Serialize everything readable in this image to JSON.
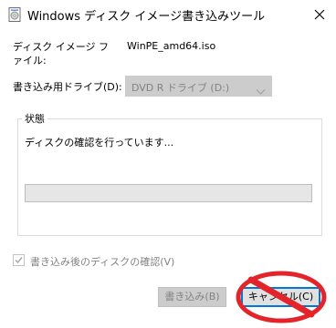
{
  "window": {
    "title": "Windows ディスク イメージ書き込みツール",
    "icon": "disc-writer-icon",
    "close_icon": "close-icon"
  },
  "form": {
    "image_file_label": "ディスク イメージ ファイル:",
    "image_file_value": "WinPE_amd64.iso",
    "drive_label": "書き込み用ドライブ(D):",
    "drive_selected": "DVD R ドライブ (D:)"
  },
  "status": {
    "group_label": "状態",
    "message": "ディスクの確認を行っています...",
    "progress_fraction": 0
  },
  "verify": {
    "label": "書き込み後のディスクの確認(V)",
    "checked": true,
    "enabled": false
  },
  "buttons": {
    "write_label": "書き込み(B)",
    "write_enabled": false,
    "cancel_label": "キャンセル(C)"
  },
  "overlay": {
    "icon": "no-entry-icon",
    "color": "#e3242b"
  },
  "colors": {
    "accent": "#0078d7",
    "disabled_text": "#838383",
    "disabled_bg": "#cccccc"
  }
}
